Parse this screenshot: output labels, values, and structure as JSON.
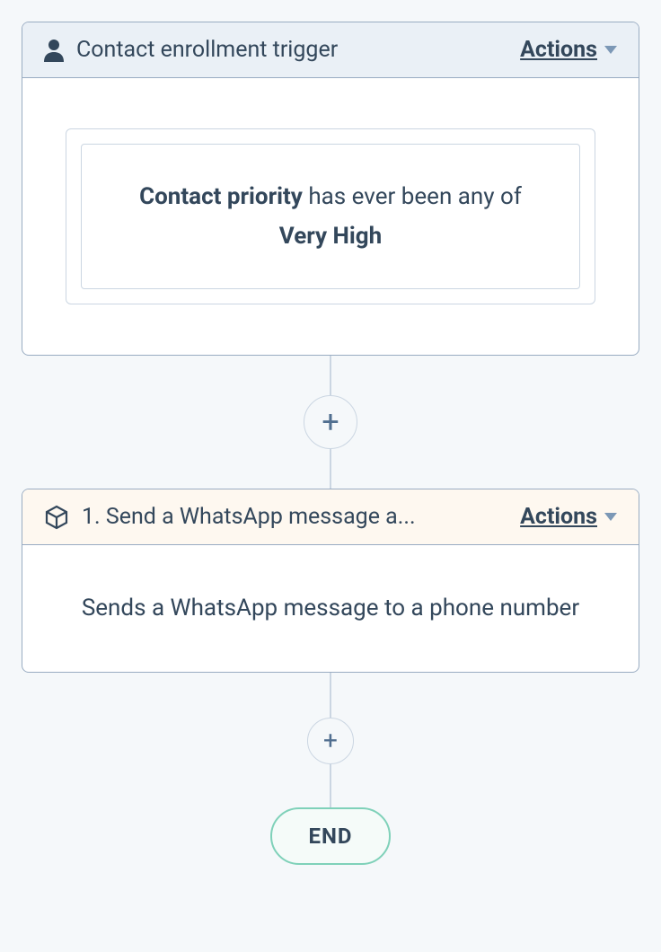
{
  "trigger": {
    "title": "Contact enrollment trigger",
    "actions_label": "Actions",
    "condition": {
      "property": "Contact priority",
      "operator_text": "has ever been any of",
      "value": "Very High"
    }
  },
  "action": {
    "step_prefix": "1.",
    "title": "Send a WhatsApp message a...",
    "actions_label": "Actions",
    "description": "Sends a WhatsApp message to a phone number"
  },
  "end": {
    "label": "END"
  }
}
